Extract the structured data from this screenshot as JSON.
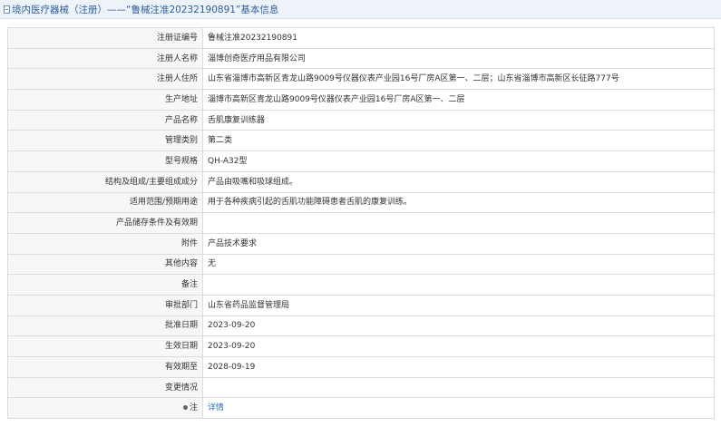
{
  "header": {
    "title": "境内医疗器械（注册）——“鲁械注准20232190891”基本信息"
  },
  "rows": [
    {
      "label": "注册证编号",
      "value": "鲁械注准20232190891"
    },
    {
      "label": "注册人名称",
      "value": "淄博创奇医疗用品有限公司"
    },
    {
      "label": "注册人住所",
      "value": "山东省淄博市高新区青龙山路9009号仪器仪表产业园16号厂房A区第一、二层；山东省淄博市高新区长征路777号"
    },
    {
      "label": "生产地址",
      "value": "淄博市高新区青龙山路9009号仪器仪表产业园16号厂房A区第一、二层"
    },
    {
      "label": "产品名称",
      "value": "舌肌康复训练器"
    },
    {
      "label": "管理类别",
      "value": "第二类"
    },
    {
      "label": "型号规格",
      "value": "QH-A32型"
    },
    {
      "label": "结构及组成/主要组成成分",
      "value": "产品由吸嘴和吸球组成。"
    },
    {
      "label": "适用范围/预期用途",
      "value": "用于各种疾病引起的舌肌功能障碍患者舌肌的康复训练。"
    },
    {
      "label": "产品储存条件及有效期",
      "value": ""
    },
    {
      "label": "附件",
      "value": "产品技术要求"
    },
    {
      "label": "其他内容",
      "value": "无"
    },
    {
      "label": "备注",
      "value": ""
    },
    {
      "label": "审批部门",
      "value": "山东省药品监督管理局"
    },
    {
      "label": "批准日期",
      "value": "2023-09-20"
    },
    {
      "label": "生效日期",
      "value": "2023-09-20"
    },
    {
      "label": "有效期至",
      "value": "2028-09-19"
    },
    {
      "label": "变更情况",
      "value": ""
    }
  ],
  "note_row": {
    "label": "注",
    "link_text": "详情"
  }
}
